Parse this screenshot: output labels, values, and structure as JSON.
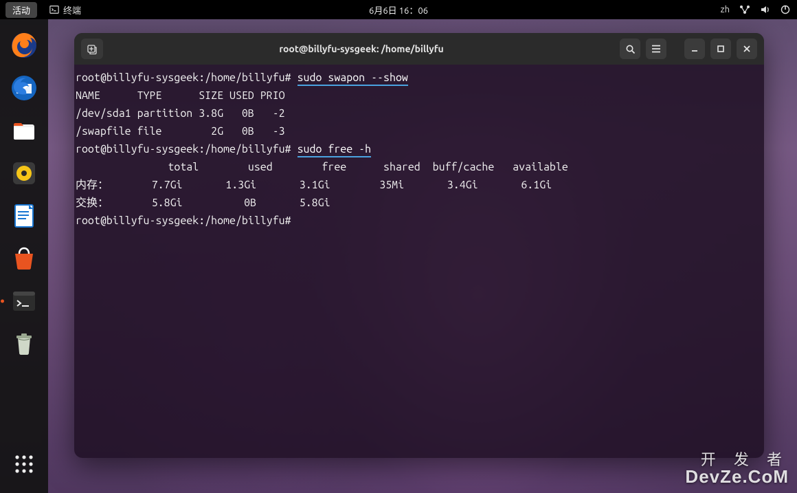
{
  "top_bar": {
    "activities": "活动",
    "app_name": "终端",
    "clock": "6月6日 16：06",
    "input_method": "zh"
  },
  "dock": {
    "items": [
      {
        "name": "firefox-icon"
      },
      {
        "name": "thunderbird-icon"
      },
      {
        "name": "files-icon"
      },
      {
        "name": "rhythmbox-icon"
      },
      {
        "name": "libreoffice-writer-icon"
      },
      {
        "name": "software-store-icon"
      },
      {
        "name": "terminal-icon",
        "active": true
      },
      {
        "name": "trash-icon"
      }
    ]
  },
  "terminal": {
    "title": "root@billyfu-sysgeek: /home/billyfu",
    "prompt": "root@billyfu-sysgeek:/home/billyfu#",
    "cmd1": "sudo swapon --show",
    "swapon_header": "NAME      TYPE      SIZE USED PRIO",
    "swapon_rows": [
      "/dev/sda1 partition 3.8G   0B   -2",
      "/swapfile file        2G   0B   -3"
    ],
    "cmd2": "sudo free -h",
    "free_header": "               total        used        free      shared  buff/cache   available",
    "free_rows": [
      "内存：       7.7Gi       1.3Gi       3.1Gi        35Mi       3.4Gi       6.1Gi",
      "交换：       5.8Gi          0B       5.8Gi"
    ]
  },
  "watermark": {
    "line1": "开 发 者",
    "line2": "DevZe.CoM"
  },
  "chart_data": {
    "type": "table",
    "title": "swapon / free -h output",
    "tables": [
      {
        "name": "swapon --show",
        "columns": [
          "NAME",
          "TYPE",
          "SIZE",
          "USED",
          "PRIO"
        ],
        "rows": [
          [
            "/dev/sda1",
            "partition",
            "3.8G",
            "0B",
            -2
          ],
          [
            "/swapfile",
            "file",
            "2G",
            "0B",
            -3
          ]
        ]
      },
      {
        "name": "free -h",
        "columns": [
          "",
          "total",
          "used",
          "free",
          "shared",
          "buff/cache",
          "available"
        ],
        "rows": [
          [
            "内存：",
            "7.7Gi",
            "1.3Gi",
            "3.1Gi",
            "35Mi",
            "3.4Gi",
            "6.1Gi"
          ],
          [
            "交换：",
            "5.8Gi",
            "0B",
            "5.8Gi",
            "",
            "",
            ""
          ]
        ]
      }
    ]
  }
}
